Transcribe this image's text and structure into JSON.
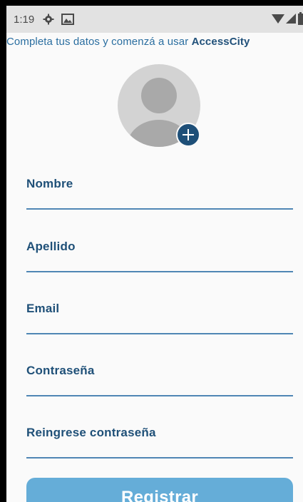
{
  "status_bar": {
    "time": "1:19",
    "left_icons": [
      "settings-gear-icon",
      "image-notification-icon"
    ],
    "right_icons": [
      "wifi-icon",
      "signal-icon",
      "battery-icon"
    ]
  },
  "header": {
    "subtitle_prefix": "Completa tus datos y comenzá a usar ",
    "brand": "AccessCity"
  },
  "avatar": {
    "icon": "person-placeholder-icon",
    "add_button_icon": "plus-icon"
  },
  "form": {
    "fields": [
      {
        "label": "Nombre",
        "value": ""
      },
      {
        "label": "Apellido",
        "value": ""
      },
      {
        "label": "Email",
        "value": ""
      },
      {
        "label": "Contraseña",
        "value": ""
      },
      {
        "label": "Reingrese contraseña",
        "value": ""
      }
    ],
    "submit_label": "Registrar"
  },
  "colors": {
    "primary": "#1f5078",
    "link": "#2a6ea0",
    "button": "#65add8",
    "underline": "#4f86b4",
    "status_bar": "#e2e2e2"
  }
}
